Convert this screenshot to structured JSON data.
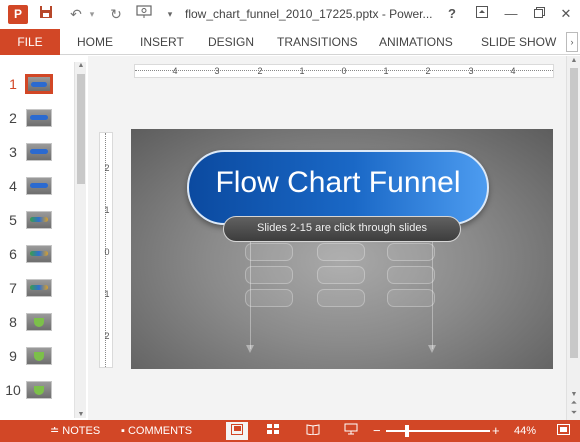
{
  "window": {
    "title": "flow_chart_funnel_2010_17225.pptx - Power...",
    "app_icon": "powerpoint-icon",
    "quick_access": [
      "save-icon",
      "undo-icon",
      "redo-icon",
      "presenter-icon",
      "customize-icon"
    ],
    "controls": [
      "help-icon",
      "ribbon-display-icon",
      "minimize-icon",
      "restore-icon",
      "close-icon"
    ]
  },
  "ribbon": {
    "file_label": "FILE",
    "tabs": [
      "HOME",
      "INSERT",
      "DESIGN",
      "TRANSITIONS",
      "ANIMATIONS",
      "SLIDE SHOW"
    ]
  },
  "thumbnails": [
    {
      "num": "1",
      "active": true,
      "style": "blue"
    },
    {
      "num": "2",
      "active": false,
      "style": "blue"
    },
    {
      "num": "3",
      "active": false,
      "style": "blue"
    },
    {
      "num": "4",
      "active": false,
      "style": "blue"
    },
    {
      "num": "5",
      "active": false,
      "style": "color"
    },
    {
      "num": "6",
      "active": false,
      "style": "color"
    },
    {
      "num": "7",
      "active": false,
      "style": "color"
    },
    {
      "num": "8",
      "active": false,
      "style": "funnel"
    },
    {
      "num": "9",
      "active": false,
      "style": "funnel"
    },
    {
      "num": "10",
      "active": false,
      "style": "funnel"
    }
  ],
  "ruler": {
    "horizontal_labels": [
      "4",
      "3",
      "2",
      "1",
      "0",
      "1",
      "2",
      "3",
      "4"
    ],
    "vertical_labels": [
      "2",
      "1",
      "0",
      "1",
      "2"
    ]
  },
  "slide": {
    "title": "Flow Chart Funnel",
    "subtitle": "Slides 2-15 are click through slides"
  },
  "statusbar": {
    "notes_label": "NOTES",
    "comments_label": "COMMENTS",
    "zoom_label": "44%",
    "zoom_minus": "−",
    "zoom_plus": "+",
    "zoom_level": 0.44,
    "color": "#d24726"
  },
  "colors": {
    "accent": "#d24726",
    "title_box": "#1a68c6"
  }
}
